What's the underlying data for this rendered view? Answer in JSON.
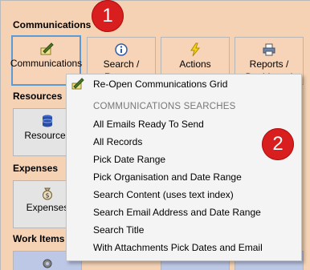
{
  "sections": {
    "communications": "Communications",
    "resources": "Resources",
    "expenses": "Expenses",
    "work_items": "Work Items"
  },
  "tiles": {
    "communications": {
      "label": "Communications",
      "icon": "pen-paper-icon"
    },
    "search_reports": {
      "label": "Search / Reports",
      "icon": "info-icon"
    },
    "actions": {
      "label": "Actions",
      "icon": "lightning-icon"
    },
    "reports_dashboard": {
      "label": "Reports / Dashboard",
      "icon": "printer-icon"
    },
    "resources": {
      "label": "Resources",
      "icon": "database-icon"
    },
    "expenses": {
      "label": "Expenses",
      "icon": "money-bag-icon"
    }
  },
  "badges": {
    "one": "1",
    "two": "2"
  },
  "menu": {
    "reopen": "Re-Open Communications Grid",
    "header": "COMMUNICATIONS SEARCHES",
    "items": [
      "All Emails Ready To Send",
      "All Records",
      "Pick Date Range",
      "Pick Organisation and Date Range",
      "Search Content (uses text index)",
      "Search Email Address and Date Range",
      "Search Title",
      "With Attachments Pick Dates and Email"
    ]
  },
  "colors": {
    "background": "#f5d2b4",
    "badge": "#d81e1e",
    "selection": "#5b9bd5"
  }
}
